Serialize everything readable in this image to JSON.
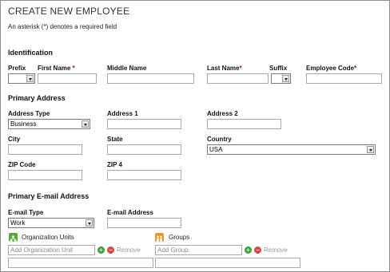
{
  "form": {
    "title": "CREATE NEW EMPLOYEE",
    "required_note": "An asterisk (*) denotes a required field"
  },
  "identification": {
    "heading": "Identification",
    "prefix_label": "Prefix",
    "first_name_label": "First Name",
    "middle_name_label": "Middle Name",
    "last_name_label": "Last Name",
    "suffix_label": "Suffix",
    "employee_code_label": "Employee Code",
    "required_mark": "*"
  },
  "primary_address": {
    "heading": "Primary Address",
    "address_type_label": "Address Type",
    "address_type_value": "Business",
    "address1_label": "Address 1",
    "address2_label": "Address 2",
    "city_label": "City",
    "state_label": "State",
    "country_label": "Country",
    "country_value": "USA",
    "zip_label": "ZIP Code",
    "zip4_label": "ZIP 4"
  },
  "primary_email": {
    "heading": "Primary E-mail Address",
    "email_type_label": "E-mail Type",
    "email_type_value": "Work",
    "email_address_label": "E-mail Address"
  },
  "org_units": {
    "label": "Organization Units",
    "placeholder": "Add Organization Unit",
    "add_symbol": "+",
    "remove_symbol": "−",
    "remove_label": "Remove"
  },
  "groups": {
    "label": "Groups",
    "placeholder": "Add Group",
    "add_symbol": "+",
    "remove_symbol": "−",
    "remove_label": "Remove"
  },
  "colors": {
    "org_icon": "#5aa832",
    "group_icon": "#e8962a",
    "add_button": "#3aa03a",
    "remove_button": "#d64545"
  }
}
